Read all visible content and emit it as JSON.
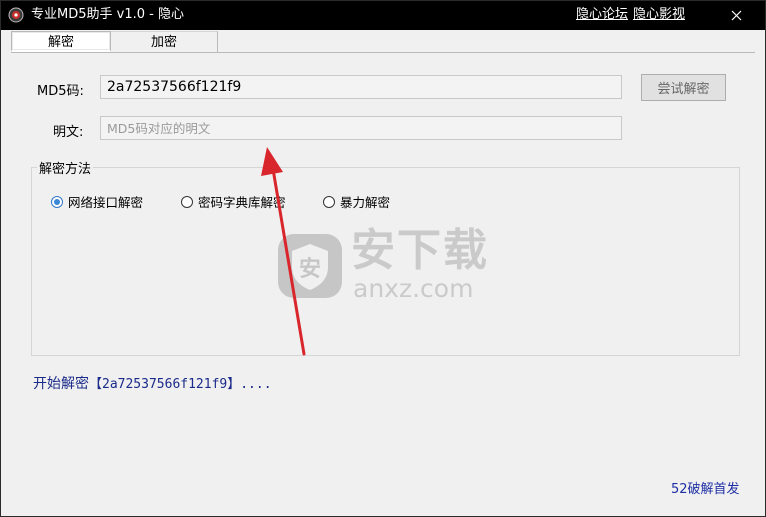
{
  "window": {
    "title": "专业MD5助手 v1.0 - 隐心",
    "links": [
      "隐心论坛",
      "隐心影视"
    ]
  },
  "tabs": [
    {
      "label": "解密",
      "active": true
    },
    {
      "label": "加密",
      "active": false
    }
  ],
  "form": {
    "md5_label": "MD5码:",
    "md5_value": "2a72537566f121f9",
    "plain_label": "明文:",
    "plain_placeholder": "MD5码对应的明文",
    "decrypt_button": "尝试解密"
  },
  "method_group": {
    "title": "解密方法",
    "options": [
      {
        "label": "网络接口解密",
        "checked": true
      },
      {
        "label": "密码字典库解密",
        "checked": false
      },
      {
        "label": "暴力解密",
        "checked": false
      }
    ]
  },
  "status": {
    "prefix": "开始解密",
    "detail": "【2a72537566f121f9】...."
  },
  "footer": {
    "link": "52破解首发"
  },
  "watermark": {
    "big": "安下载",
    "small": "anxz.com",
    "shield_glyph": "安"
  },
  "colors": {
    "titlebar": "#000000",
    "status_text": "#1a2a8a",
    "footer_link": "#1e2fa5",
    "annotation_arrow": "#d9262c",
    "radio_accent": "#3c86d6"
  },
  "icons": {
    "app": "app-icon",
    "close": "close-icon",
    "watermark": "shield-icon",
    "annotation": "red-arrow-icon"
  }
}
